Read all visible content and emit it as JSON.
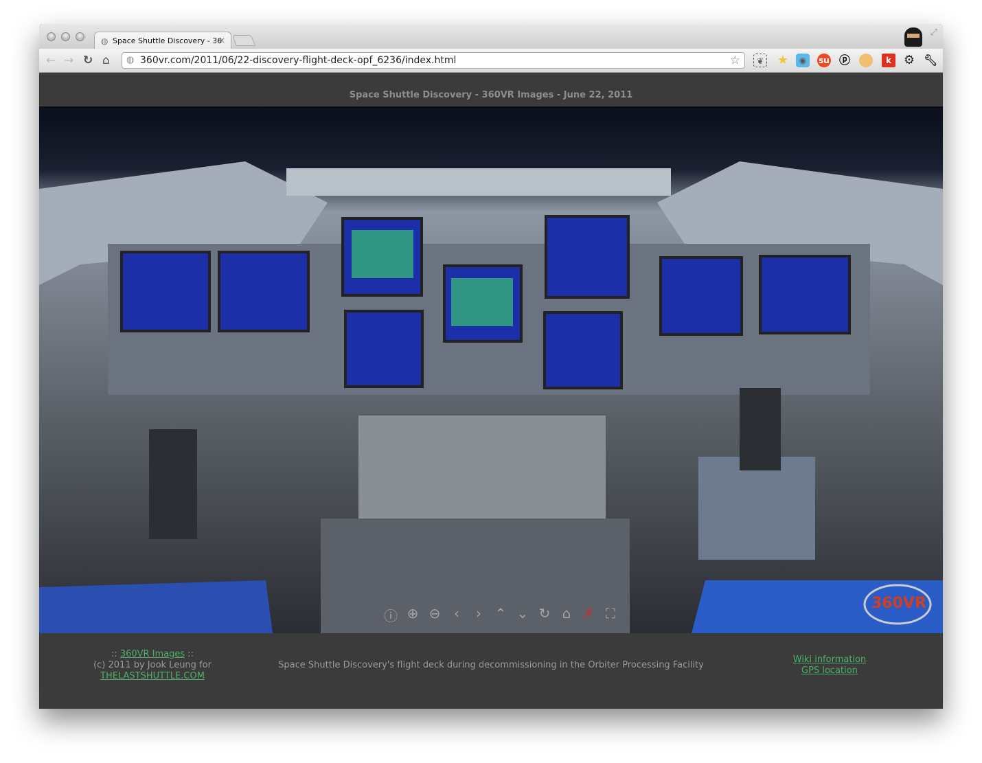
{
  "browser": {
    "tab_title": "Space Shuttle Discovery - 36",
    "url": "360vr.com/2011/06/22-discovery-flight-deck-opf_6236/index.html",
    "extensions": [
      {
        "icon": "evernote-icon",
        "color": "#555555"
      },
      {
        "icon": "bookmark-star-g-icon",
        "color": "#f3c53a"
      },
      {
        "icon": "hootsuite-owl-icon",
        "color": "#5ab8e8"
      },
      {
        "icon": "stumbleupon-icon",
        "color": "#eb4924"
      },
      {
        "icon": "pinterest-icon",
        "color": "#111111"
      },
      {
        "icon": "pufferfish-icon",
        "color": "#f0c070"
      },
      {
        "icon": "klout-icon",
        "color": "#e0301e",
        "label": "k"
      },
      {
        "icon": "settings-gear-icon",
        "color": "#222222"
      },
      {
        "icon": "wrench-icon",
        "color": "#333333"
      }
    ]
  },
  "page": {
    "title": "Space Shuttle Discovery - 360VR Images - June 22, 2011"
  },
  "panorama": {
    "logo_text": "360 VR",
    "controls": [
      "info-icon",
      "zoom-in-icon",
      "zoom-out-icon",
      "pan-left-icon",
      "pan-right-icon",
      "pan-up-icon",
      "pan-down-icon",
      "autorotate-icon",
      "home-icon",
      "hotspots-off-icon",
      "fullscreen-icon"
    ]
  },
  "footer": {
    "left_prefix": ":: ",
    "left_link": "360VR Images",
    "left_suffix": " ::",
    "credit": "(c) 2011 by Jook Leung for",
    "credit_link": "THELASTSHUTTLE.COM",
    "caption": "Space Shuttle Discovery's flight deck during decommissioning in the Orbiter Processing Facility",
    "wiki_link": "Wiki information",
    "gps_link": "GPS location"
  }
}
